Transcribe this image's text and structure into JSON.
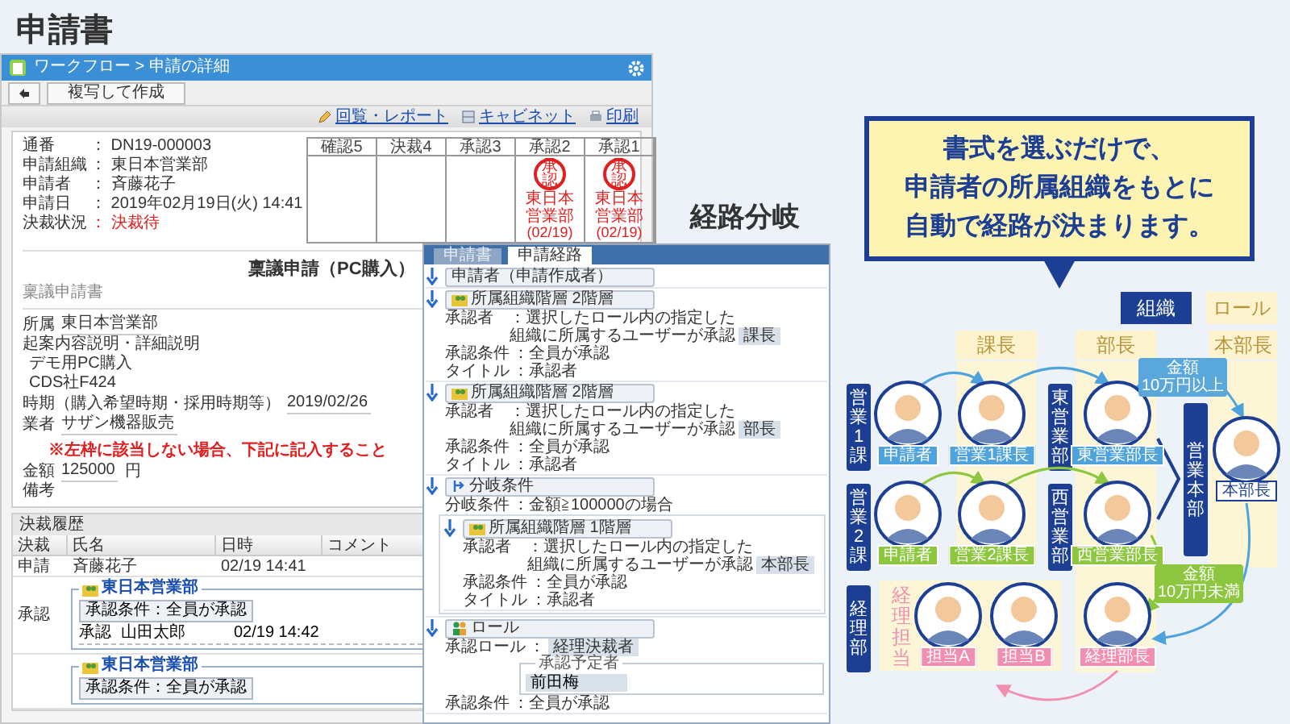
{
  "page_title": "申請書",
  "left_window": {
    "breadcrumb": "ワークフロー > 申請の詳細",
    "toolbar_buttons": [
      "複写して作成"
    ],
    "links": [
      "回覧・レポート",
      "キャビネット",
      "印刷"
    ],
    "fields": [
      {
        "label": "通番",
        "value": "： DN19-000003",
        "alert": false
      },
      {
        "label": "申請組織",
        "value": "： 東日本営業部",
        "alert": false
      },
      {
        "label": "申請者",
        "value": "： 斉藤花子",
        "alert": false
      },
      {
        "label": "申請日",
        "value": "： 2019年02月19日(火) 14:41",
        "alert": false
      },
      {
        "label": "決裁状況",
        "value": "： 決裁待",
        "alert": true
      }
    ],
    "stamp_columns": [
      {
        "header": "確認5",
        "stamped": false
      },
      {
        "header": "決裁4",
        "stamped": false
      },
      {
        "header": "承認3",
        "stamped": false
      },
      {
        "header": "承認2",
        "stamped": true,
        "stamp": "承認",
        "org": "東日本営業部",
        "date": "(02/19)"
      },
      {
        "header": "承認1",
        "stamped": true,
        "stamp": "承認",
        "org": "東日本営業部",
        "date": "(02/19)"
      }
    ],
    "form_title": "稟議申請（PC購入）",
    "form_name": "稟議申請書",
    "form_rows": [
      {
        "kind": "field",
        "label": "所属",
        "value": "東日本営業部"
      },
      {
        "kind": "heading",
        "text": "起案内容説明・詳細説明"
      },
      {
        "kind": "text",
        "text": "デモ用PC購入"
      },
      {
        "kind": "text",
        "text": "CDS社F424"
      },
      {
        "kind": "field",
        "label": "時期（購入希望時期・採用時期等）",
        "value": "2019/02/26"
      },
      {
        "kind": "field",
        "label": "業者",
        "value": "サザン機器販売",
        "note": "※左枠に該当しない場合、下記に記入すること"
      },
      {
        "kind": "field",
        "label": "金額",
        "value": "125000",
        "unit": "円"
      },
      {
        "kind": "heading",
        "text": "備考"
      }
    ],
    "history": {
      "title": "決裁履歴",
      "columns": [
        "決裁",
        "氏名",
        "日時",
        "コメント"
      ],
      "rows": [
        {
          "action": "申請",
          "name": "斉藤花子",
          "date": "02/19 14:41"
        }
      ],
      "groups": [
        {
          "action": "承認",
          "org": "東日本営業部",
          "condition": "承認条件：全員が承認",
          "entries": [
            {
              "action": "承認",
              "name": "山田太郎",
              "date": "02/19 14:42"
            }
          ]
        },
        {
          "org": "東日本営業部",
          "condition": "承認条件：全員が承認"
        }
      ]
    }
  },
  "route_heading": "経路分岐",
  "route_panel": {
    "tabs": [
      {
        "label": "申請書",
        "selected": false
      },
      {
        "label": "申請経路",
        "selected": true
      }
    ],
    "steps": [
      {
        "kind": "applicant",
        "title": "申請者（申請作成者）"
      },
      {
        "kind": "org",
        "title": "所属組織階層 2階層",
        "rows": [
          {
            "label": "承認者",
            "value": "：選択したロール内の指定した組織に所属するユーザーが承認",
            "chip": "課長"
          },
          {
            "label": "承認条件",
            "value": "：全員が承認"
          },
          {
            "label": "タイトル",
            "value": "：承認者"
          }
        ]
      },
      {
        "kind": "org",
        "title": "所属組織階層 2階層",
        "rows": [
          {
            "label": "承認者",
            "value": "：選択したロール内の指定した組織に所属するユーザーが承認",
            "chip": "部長"
          },
          {
            "label": "承認条件",
            "value": "：全員が承認"
          },
          {
            "label": "タイトル",
            "value": "：承認者"
          }
        ]
      },
      {
        "kind": "branch",
        "title": "分岐条件",
        "rows": [
          {
            "label": "分岐条件",
            "value": "：金額≧100000の場合"
          }
        ],
        "children": [
          {
            "kind": "org",
            "title": "所属組織階層 1階層",
            "rows": [
              {
                "label": "承認者",
                "value": "：選択したロール内の指定した組織に所属するユーザーが承認",
                "chip": "本部長"
              },
              {
                "label": "承認条件",
                "value": "：全員が承認"
              },
              {
                "label": "タイトル",
                "value": "：承認者"
              }
            ]
          }
        ]
      },
      {
        "kind": "role",
        "title": "ロール",
        "rows": [
          {
            "label": "承認ロール",
            "value": "：",
            "chip": "経理決裁者"
          },
          {
            "legend": "承認予定者",
            "chip": "前田梅"
          },
          {
            "label": "承認条件",
            "value": "：全員が承認"
          }
        ]
      }
    ]
  },
  "route_diagram": {
    "callout": [
      "書式を選ぶだけで、",
      "申請者の所属組織をもとに",
      "自動で経路が決まります。"
    ],
    "legend": [
      {
        "label": "組織",
        "kind": "org"
      },
      {
        "label": "ロール",
        "kind": "role"
      }
    ],
    "role_columns": [
      "課長",
      "部長",
      "本部長"
    ],
    "org_labels": [
      "営業1課",
      "営業2課",
      "経理部",
      "東営業部",
      "西営業部",
      "営業本部"
    ],
    "group_label": "経理担当",
    "people": [
      {
        "label": "申請者",
        "color": "#4fa3dc"
      },
      {
        "label": "営業1課長",
        "color": "#4fa3dc"
      },
      {
        "label": "東営業部長",
        "color": "#4fa3dc"
      },
      {
        "label": "申請者",
        "color": "#8dc63f"
      },
      {
        "label": "営業2課長",
        "color": "#8dc63f"
      },
      {
        "label": "西営業部長",
        "color": "#8dc63f"
      },
      {
        "label": "担当A",
        "color": "#f08fb0"
      },
      {
        "label": "担当B",
        "color": "#f08fb0"
      },
      {
        "label": "経理部長",
        "color": "#f08fb0"
      },
      {
        "label": "本部長",
        "color": "#ffffff"
      }
    ],
    "conditions": [
      {
        "lines": [
          "金額",
          "10万円以上"
        ],
        "color": "#5aa7dc"
      },
      {
        "lines": [
          "金額",
          "10万円未満"
        ],
        "color": "#8dc63f"
      }
    ]
  }
}
